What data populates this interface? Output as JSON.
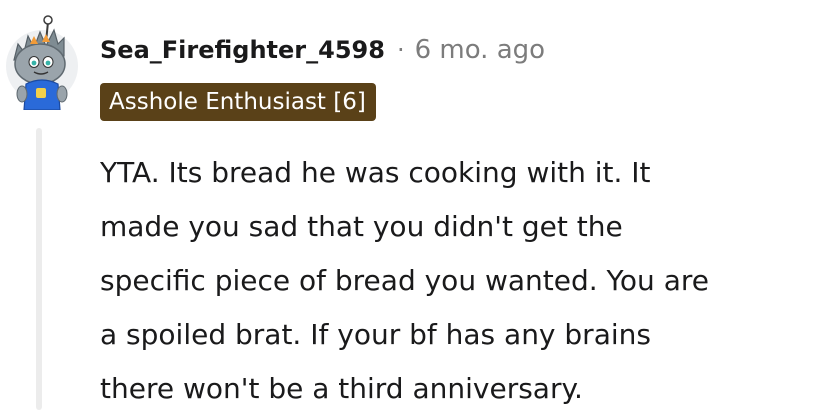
{
  "comment": {
    "author": "Sea_Firefighter_4598",
    "separator": "·",
    "timestamp": "6 mo. ago",
    "flair": "Asshole Enthusiast [6]",
    "body_lines": [
      "YTA. Its bread he was cooking with it. It",
      "made you sad that you didn't get the",
      "specific piece of bread you wanted. You are",
      "a spoiled brat. If your bf has any brains",
      "there won't be a third anniversary."
    ]
  },
  "colors": {
    "flair_background": "#5a4118",
    "flair_text": "#ffffff",
    "meta_text": "#7c7c7c",
    "thread_line": "#ececec",
    "avatar_body": "#8a949c",
    "avatar_shirt": "#2a6ad9"
  },
  "icons": {
    "avatar": "snoo-avatar-icon"
  }
}
